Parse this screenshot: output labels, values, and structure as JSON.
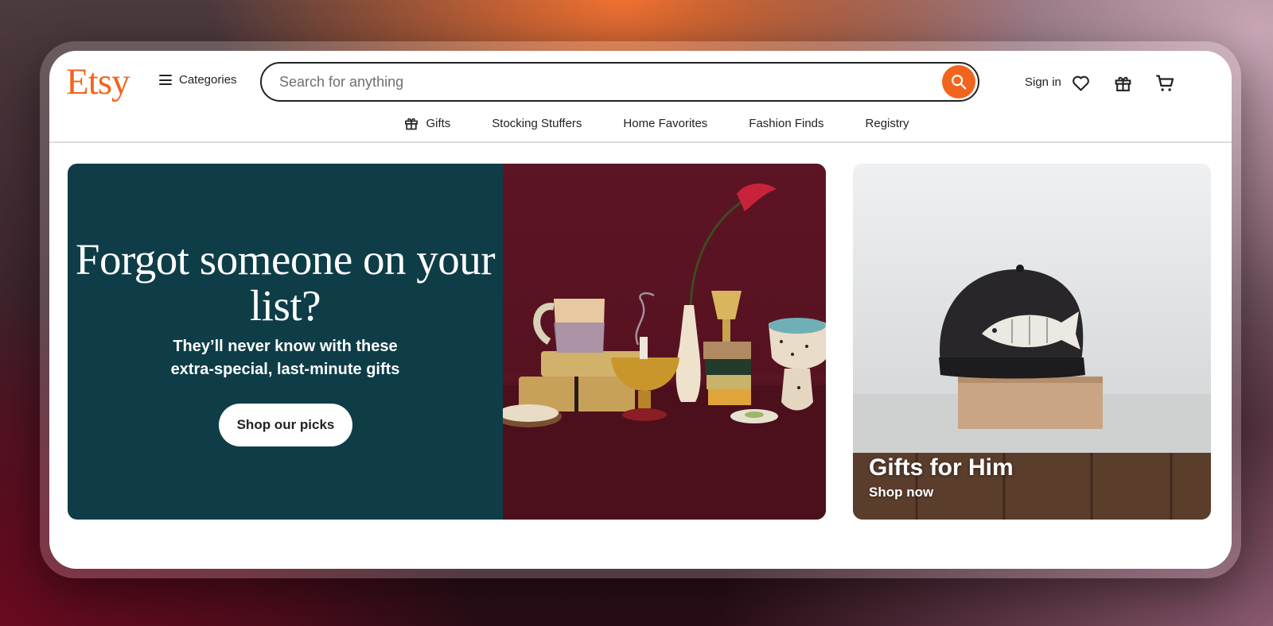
{
  "header": {
    "logo": "Etsy",
    "categories_label": "Categories",
    "search_placeholder": "Search for anything",
    "sign_in": "Sign in",
    "icons": [
      "heart-icon",
      "gift-icon",
      "cart-icon"
    ]
  },
  "nav": {
    "items": [
      {
        "label": "Gifts",
        "icon": "gift-icon"
      },
      {
        "label": "Stocking Stuffers"
      },
      {
        "label": "Home Favorites"
      },
      {
        "label": "Fashion Finds"
      },
      {
        "label": "Registry"
      }
    ]
  },
  "hero": {
    "title": "Forgot someone on your list?",
    "subtitle_line1": "They’ll never know with these",
    "subtitle_line2": "extra-special, last-minute gifts",
    "button": "Shop our picks"
  },
  "side_card": {
    "title": "Gifts for Him",
    "link": "Shop now"
  },
  "colors": {
    "brand": "#f1641e",
    "hero_bg": "#0e3d48",
    "hero_image_bg": "#5d1424"
  }
}
